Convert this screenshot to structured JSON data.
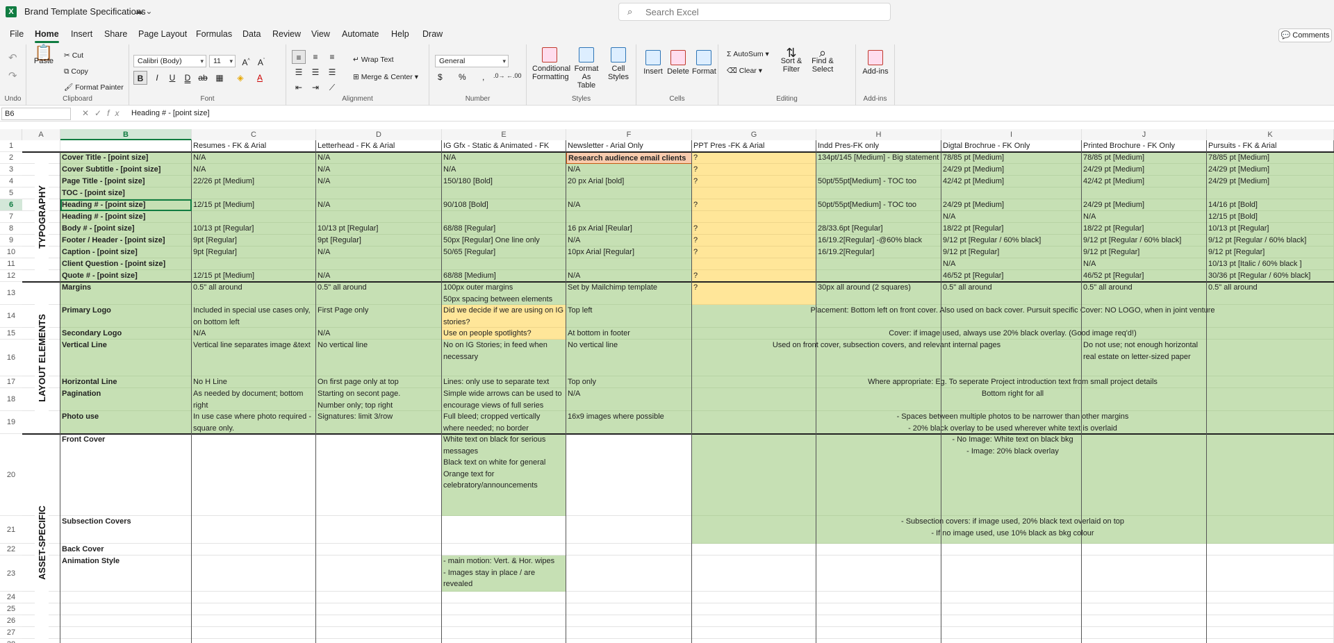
{
  "app": {
    "title": "Brand Template Specifications",
    "autosave_icon": "autosave-icon",
    "search_placeholder": "Search Excel"
  },
  "menu": [
    "File",
    "Home",
    "Insert",
    "Share",
    "Page Layout",
    "Formulas",
    "Data",
    "Review",
    "View",
    "Automate",
    "Help",
    "Draw"
  ],
  "menu_active": "Home",
  "comments_label": "Comments",
  "ribbon": {
    "undo": "Undo",
    "clipboard": {
      "label": "Clipboard",
      "paste": "Paste",
      "cut": "Cut",
      "copy": "Copy",
      "format_painter": "Format Painter"
    },
    "font": {
      "label": "Font",
      "family": "Calibri (Body)",
      "size": "11"
    },
    "alignment": {
      "label": "Alignment",
      "wrap": "Wrap Text",
      "merge": "Merge & Center"
    },
    "number": {
      "label": "Number",
      "format": "General"
    },
    "styles": {
      "label": "Styles",
      "conditional": "Conditional Formatting",
      "format_table": "Format As Table",
      "cell_styles": "Cell Styles"
    },
    "cells": {
      "label": "Cells",
      "insert": "Insert",
      "delete": "Delete",
      "format": "Format"
    },
    "editing": {
      "label": "Editing",
      "autosum": "AutoSum",
      "clear": "Clear",
      "sort": "Sort & Filter",
      "find": "Find & Select"
    },
    "addins": {
      "label": "Add-ins",
      "addins": "Add-ins"
    }
  },
  "formula_bar": {
    "name_box": "B6",
    "formula": "Heading # - [point size]"
  },
  "columns": [
    "A",
    "B",
    "C",
    "D",
    "E",
    "F",
    "G",
    "H",
    "I",
    "J",
    "K"
  ],
  "selected_column": "B",
  "selected_row": "6",
  "rows": [
    "1",
    "2",
    "3",
    "4",
    "5",
    "6",
    "7",
    "8",
    "9",
    "10",
    "11",
    "12",
    "13",
    "14",
    "15",
    "16",
    "17",
    "18",
    "19",
    "20",
    "21",
    "22",
    "23",
    "24",
    "25",
    "26",
    "27",
    "28"
  ],
  "section_labels": {
    "typography": "TYPOGRAPHY",
    "layout": "LAYOUT ELEMENTS",
    "asset": "ASSET-SPECIFIC"
  },
  "header_row": {
    "C": "Resumes - FK & Arial",
    "D": "Letterhead -  FK & Arial",
    "E": "IG Gfx - Static & Animated - FK",
    "F": "Newsletter - Arial Only",
    "G": "PPT Pres  -FK & Arial",
    "H": "Indd Pres-FK only",
    "I": "Digtal Brochrue - FK Only",
    "J": "Printed Brochure - FK Only",
    "K": "Pursuits - FK & Arial"
  },
  "labels": {
    "r2": "Cover Title - [point size]",
    "r3": "Cover Subtitle - [point size]",
    "r4": "Page Title - [point size]",
    "r5": "TOC - [point size]",
    "r6": "Heading # - [point size]",
    "r7": "Heading # - [point size]",
    "r8": "Body # - [point size]",
    "r9": "Footer / Header - [point size]",
    "r10": "Caption - [point size]",
    "r11": "Client Question - [point size]",
    "r12": "Quote # - [point size]",
    "r13": "Margins",
    "r14": "Primary Logo",
    "r15": "Secondary Logo",
    "r16": "Vertical Line",
    "r17": "Horizontal Line",
    "r18": "Pagination",
    "r19": "Photo use",
    "r20": "Front Cover",
    "r21": "Subsection Covers",
    "r22": "Back Cover",
    "r23": "Animation Style"
  },
  "cells": {
    "C2": "N/A",
    "D2": "N/A",
    "E2": "N/A",
    "F2": "Research audience email clients",
    "G2": "?",
    "H2": "134pt/145 [Medium] - Big statement",
    "I2": "78/85 pt [Medium]",
    "J2": "78/85 pt [Medium]",
    "K2": "78/85 pt [Medium]",
    "C3": "N/A",
    "D3": "N/A",
    "E3": "N/A",
    "F3": "N/A",
    "G3": "?",
    "I3": "24/29 pt [Medium]",
    "J3": "24/29 pt [Medium]",
    "K3": "24/29 pt [Medium]",
    "C4": "22/26 pt [Medium]",
    "D4": "N/A",
    "E4": "150/180 [Bold]",
    "F4": "20 px Arial [bold]",
    "G4": "?",
    "H4": "50pt/55pt[Medium] - TOC too",
    "I4": "42/42 pt [Medium]",
    "J4": "42/42 pt [Medium]",
    "K4": "24/29 pt [Medium]",
    "C6": "12/15 pt [Medium]",
    "D6": "N/A",
    "E6": "90/108 [Bold]",
    "F6": "N/A",
    "G6": "?",
    "H6": "50pt/55pt[Medium] - TOC too",
    "I6": "24/29 pt [Medium]",
    "J6": "24/29 pt [Medium]",
    "K6": "14/16 pt [Bold]",
    "I7": "N/A",
    "J7": "N/A",
    "K7": "12/15 pt [Bold]",
    "C8": "10/13 pt [Regular]",
    "D8": "10/13 pt [Regular]",
    "E8": "68/88 [Regular]",
    "F8": "16 px Arial [Reular]",
    "G8": "?",
    "H8": "28/33.6pt [Regular]",
    "I8": "18/22 pt [Regular]",
    "J8": "18/22 pt [Regular]",
    "K8": "10/13 pt [Regular]",
    "C9": "9pt [Regular]",
    "D9": "9pt [Regular]",
    "E9": "50px [Regular] One line only",
    "F9": "N/A",
    "G9": "?",
    "H9": "16/19.2[Regular] -@60% black",
    "I9": "9/12 pt [Regular / 60% black]",
    "J9": "9/12 pt [Regular / 60% black]",
    "K9": "9/12 pt [Regular / 60% black]",
    "C10": "9pt [Regular]",
    "D10": "N/A",
    "E10": "50/65 [Regular]",
    "F10": "10px Arial [Regular]",
    "G10": "?",
    "H10": "16/19.2[Regular]",
    "I10": "9/12 pt [Regular]",
    "J10": "9/12 pt [Regular]",
    "K10": "9/12 pt [Regular]",
    "I11": "N/A",
    "J11": "N/A",
    "K11": "10/13 pt [Italic / 60% black ]",
    "C12": "12/15 pt [Medium]",
    "D12": "N/A",
    "E12": "68/88 [Medium]",
    "F12": "N/A",
    "G12": "?",
    "I12": "46/52 pt [Regular]",
    "J12": "46/52 pt [Regular]",
    "K12": "30/36 pt [Regular / 60% black]",
    "C13": "0.5\" all around",
    "D13": "0.5\" all around",
    "E13a": "100px outer margins",
    "E13b": "50px spacing between elements",
    "F13": "Set by Mailchimp template",
    "G13": "?",
    "H13": "30px all around (2 squares)",
    "I13": "0.5\" all around",
    "J13": "0.5\" all around",
    "K13": "0.5\" all around",
    "C14a": "Included in special use cases only,",
    "C14b": "on bottom left",
    "D14": "First Page only",
    "E14a": "Did we decide if we are using on IG",
    "E14b": "stories?",
    "F14": "Top left",
    "G14": "Placement: Bottom left on front cover. Also used on back cover. Pursuit specific Cover: NO LOGO, when in joint venture",
    "C15": "N/A",
    "D15": "N/A",
    "E15": "Use on people spotlights?",
    "F15": "At bottom in footer",
    "G15": "Cover: if image used, always use 20% black overlay. (Good image req'd!)",
    "C16": "Vertical line separates image &text",
    "D16": "No vertical line",
    "E16a": "No on IG Stories; in feed when",
    "E16b": "necessary",
    "F16": "No vertical line",
    "G16": "Used on front cover, subsection covers, and relevant internal pages",
    "J16a": "Do not use; not enough horizontal",
    "J16b": "real estate on letter-sized paper",
    "C17": "No H Line",
    "D17": "On first page only at top",
    "E17": "Lines: only use to separate text",
    "F17": "Top only",
    "G17": "Where appropriate: Eg. To seperate Project introduction text from small project details",
    "C18a": "As needed by document; bottom",
    "C18b": "right",
    "D18a": "Starting on secont page.",
    "D18b": "Number only; top right",
    "E18a": "Simple wide arrows can be used to",
    "E18b": "encourage views of full series",
    "F18": "N/A",
    "G18": "Bottom right for all",
    "C19a": "In use case where photo required -",
    "C19b": "square only.",
    "D19": "Signatures: limit 3/row",
    "E19a": "Full bleed; cropped vertically",
    "E19b": "where needed; no border",
    "F19": "16x9 images where possible",
    "G19a": "- Spaces between multiple photos to be narrower than other margins",
    "G19b": "- 20% black overlay to be used wherever white text is overlaid",
    "E20a": "White text on black for serious",
    "E20b": "messages",
    "E20c": "Black text on white for general",
    "E20d": "Orange text for",
    "E20e": "celebratory/announcements",
    "G20a": "- No Image: White text on black bkg",
    "G20b": "- Image: 20% black overlay",
    "G21a": "- Subsection covers: if image used, 20% black text overlaid on top",
    "G21b": "- If no image used, use 10% black as bkg colour",
    "E23a": "- main motion: Vert. & Hor. wipes",
    "E23b": "- Images stay in place / are",
    "E23c": "revealed"
  },
  "colors": {
    "accent": "#107c41",
    "green_fill": "#c6e0b4",
    "yellow_fill": "#ffe699",
    "orange_fill": "#f8cbad"
  }
}
